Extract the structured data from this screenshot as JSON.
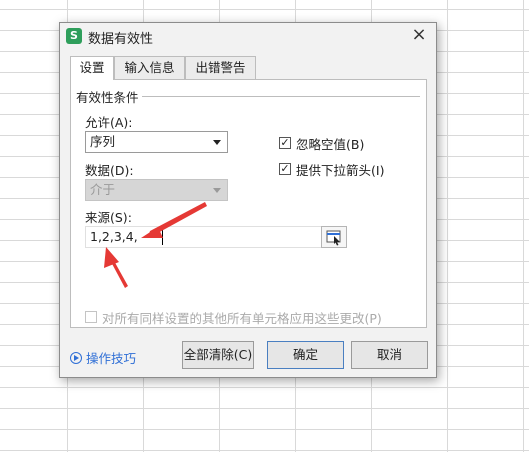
{
  "dialog": {
    "app_icon_letter": "S",
    "title": "数据有效性",
    "close_glyph": "×",
    "tabs": [
      {
        "label": "设置",
        "active": true
      },
      {
        "label": "输入信息",
        "active": false
      },
      {
        "label": "出错警告",
        "active": false
      }
    ],
    "settings": {
      "group_label": "有效性条件",
      "allow_label": "允许(A):",
      "allow_value": "序列",
      "data_label": "数据(D):",
      "data_value": "介于",
      "ignore_blank_label": "忽略空值(B)",
      "ignore_blank_checked": true,
      "dropdown_label": "提供下拉箭头(I)",
      "dropdown_checked": true,
      "source_label": "来源(S):",
      "source_value": "1,2,3,4,",
      "apply_all_label": "对所有同样设置的其他所有单元格应用这些更改(P)",
      "apply_all_checked": false
    },
    "footer": {
      "tips_label": "操作技巧",
      "clear_all_label": "全部清除(C)",
      "ok_label": "确定",
      "cancel_label": "取消"
    }
  },
  "colors": {
    "annotation_arrow": "#e53935",
    "app_icon": "#2e9e5b",
    "link": "#2f6fd6"
  }
}
